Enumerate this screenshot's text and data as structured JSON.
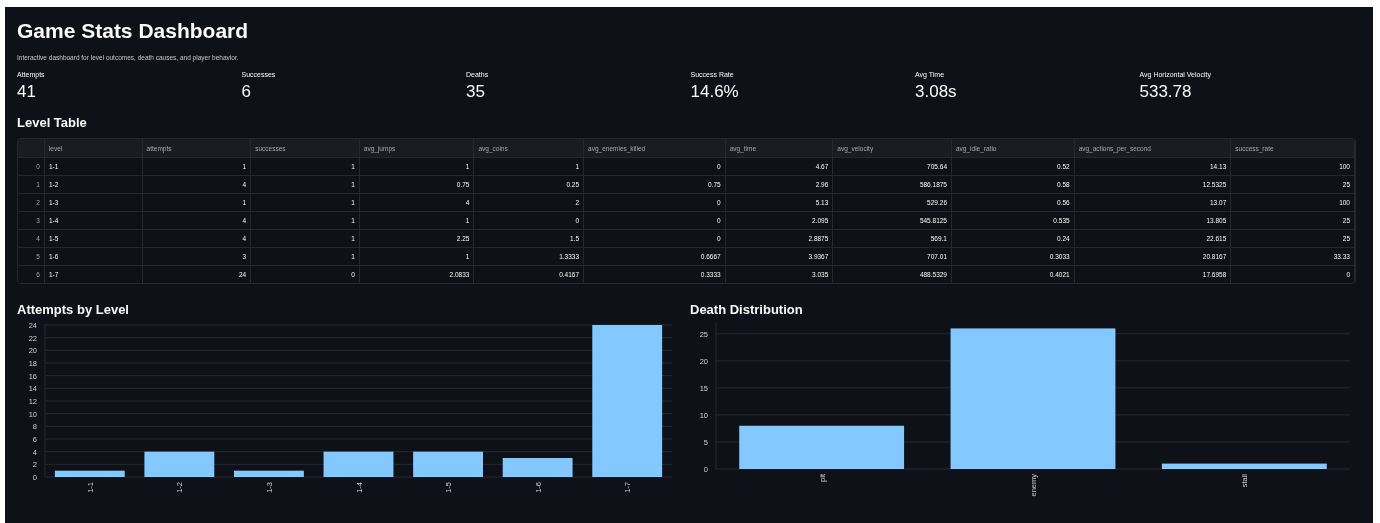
{
  "title": "Game Stats Dashboard",
  "subtitle": "Interactive dashboard for level outcomes, death causes, and player behavior.",
  "metrics": [
    {
      "label": "Attempts",
      "value": "41"
    },
    {
      "label": "Successes",
      "value": "6"
    },
    {
      "label": "Deaths",
      "value": "35"
    },
    {
      "label": "Success Rate",
      "value": "14.6%"
    },
    {
      "label": "Avg Time",
      "value": "3.08s"
    },
    {
      "label": "Avg Horizontal Velocity",
      "value": "533.78"
    }
  ],
  "level_table": {
    "heading": "Level Table",
    "columns": [
      "level",
      "attempts",
      "successes",
      "avg_jumps",
      "avg_coins",
      "avg_enemies_killed",
      "avg_time",
      "avg_velocity",
      "avg_idle_ratio",
      "avg_actions_per_second",
      "success_rate"
    ],
    "rows": [
      {
        "index": "0",
        "cells": [
          "1-1",
          "1",
          "1",
          "1",
          "1",
          "0",
          "4.67",
          "705.64",
          "0.52",
          "14.13",
          "100"
        ]
      },
      {
        "index": "1",
        "cells": [
          "1-2",
          "4",
          "1",
          "0.75",
          "0.25",
          "0.75",
          "2.96",
          "586.1875",
          "0.58",
          "12.5325",
          "25"
        ]
      },
      {
        "index": "2",
        "cells": [
          "1-3",
          "1",
          "1",
          "4",
          "2",
          "0",
          "5.13",
          "529.26",
          "0.56",
          "13.07",
          "100"
        ]
      },
      {
        "index": "3",
        "cells": [
          "1-4",
          "4",
          "1",
          "1",
          "0",
          "0",
          "2.095",
          "545.8125",
          "0.535",
          "13.805",
          "25"
        ]
      },
      {
        "index": "4",
        "cells": [
          "1-5",
          "4",
          "1",
          "2.25",
          "1.5",
          "0",
          "2.8875",
          "569.1",
          "0.24",
          "22.615",
          "25"
        ]
      },
      {
        "index": "5",
        "cells": [
          "1-6",
          "3",
          "1",
          "1",
          "1.3333",
          "0.6667",
          "3.9367",
          "707.01",
          "0.3033",
          "20.8167",
          "33.33"
        ]
      },
      {
        "index": "6",
        "cells": [
          "1-7",
          "24",
          "0",
          "2.0833",
          "0.4167",
          "0.3333",
          "3.035",
          "488.5329",
          "0.4021",
          "17.6958",
          "0"
        ]
      }
    ]
  },
  "charts": [
    {
      "heading": "Attempts by Level",
      "chart_data": {
        "type": "bar",
        "categories": [
          "1-1",
          "1-2",
          "1-3",
          "1-4",
          "1-5",
          "1-6",
          "1-7"
        ],
        "series": [
          {
            "color": "#83c9ff",
            "values": [
              1,
              4,
              1,
              4,
              4,
              3,
              24
            ]
          }
        ],
        "grid": true,
        "ylim": [
          0,
          24
        ],
        "yticks": [
          0,
          2,
          4,
          6,
          8,
          10,
          12,
          14,
          16,
          18,
          20,
          22,
          24
        ]
      }
    },
    {
      "heading": "Death Distribution",
      "chart_data": {
        "type": "bar",
        "categories": [
          "pit",
          "enemy",
          "stall"
        ],
        "series": [
          {
            "color": "#83c9ff",
            "values": [
              8,
              26,
              1
            ]
          }
        ],
        "grid": true,
        "ylim": [
          0,
          27
        ],
        "yticks": [
          0,
          5,
          10,
          15,
          20,
          25
        ]
      }
    }
  ]
}
